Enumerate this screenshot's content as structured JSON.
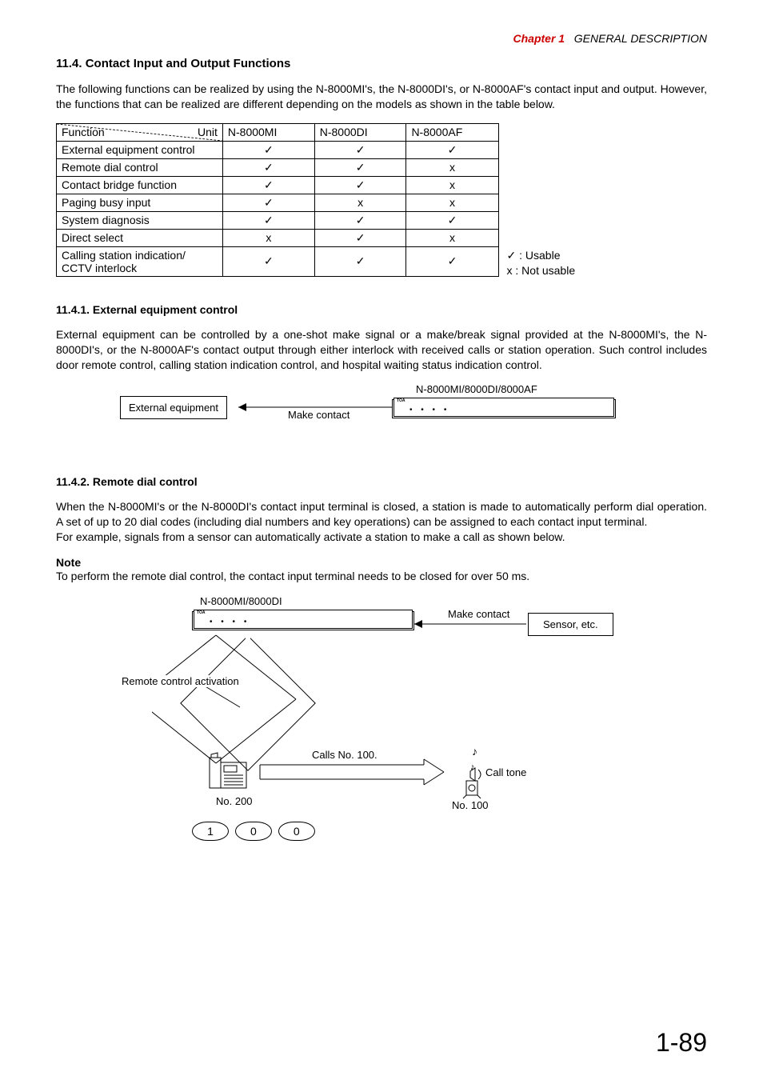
{
  "header": {
    "chapter_label": "Chapter 1",
    "chapter_title": "GENERAL DESCRIPTION"
  },
  "section": {
    "number_title": "11.4. Contact Input and Output Functions",
    "intro": "The following functions can be realized by using the N-8000MI's, the N-8000DI's, or N-8000AF's contact input and output. However, the functions that can be realized are different depending on the models as shown in the table below."
  },
  "table": {
    "corner_left": "Function",
    "corner_right": "Unit",
    "cols": [
      "N-8000MI",
      "N-8000DI",
      "N-8000AF"
    ],
    "rows": [
      {
        "name": "External equipment control",
        "vals": [
          "✓",
          "✓",
          "✓"
        ]
      },
      {
        "name": "Remote dial control",
        "vals": [
          "✓",
          "✓",
          "x"
        ]
      },
      {
        "name": "Contact bridge function",
        "vals": [
          "✓",
          "✓",
          "x"
        ]
      },
      {
        "name": "Paging busy input",
        "vals": [
          "✓",
          "x",
          "x"
        ]
      },
      {
        "name": "System diagnosis",
        "vals": [
          "✓",
          "✓",
          "✓"
        ]
      },
      {
        "name": "Direct select",
        "vals": [
          "x",
          "✓",
          "x"
        ]
      },
      {
        "name": "Calling station indication/ CCTV interlock",
        "vals": [
          "✓",
          "✓",
          "✓"
        ]
      }
    ],
    "legend_usable": "✓ : Usable",
    "legend_not": "x  : Not usable"
  },
  "sub1": {
    "title": "11.4.1. External equipment control",
    "text": "External equipment can be controlled by a one-shot make signal or a make/break signal provided at the N-8000MI's, the N-8000DI's, or the N-8000AF's contact output through either interlock with received calls or station operation. Such control includes door remote control, calling station indication control, and hospital waiting status indication control.",
    "diagram": {
      "left_box": "External equipment",
      "line_label": "Make contact",
      "right_label": "N-8000MI/8000DI/8000AF"
    }
  },
  "sub2": {
    "title": "11.4.2. Remote dial control",
    "text1": "When the N-8000MI's or the N-8000DI's contact input terminal is closed, a station is made to automatically perform dial operation. A set of up to 20 dial codes (including dial numbers and key operations) can be assigned to each contact input terminal.",
    "text2": "For example, signals from a sensor can automatically activate a station to make a call as shown below.",
    "note_title": "Note",
    "note_text": "To perform the remote dial control, the contact input terminal needs to be closed for over 50 ms.",
    "diagram": {
      "unit_label": "N-8000MI/8000DI",
      "make_contact": "Make contact",
      "sensor": "Sensor, etc.",
      "remote_activation": "Remote control activation",
      "calls_no": "Calls No. 100.",
      "call_tone": "Call tone",
      "no200": "No. 200",
      "no100": "No. 100",
      "keys": [
        "1",
        "0",
        "0"
      ]
    }
  },
  "page": "1-89"
}
